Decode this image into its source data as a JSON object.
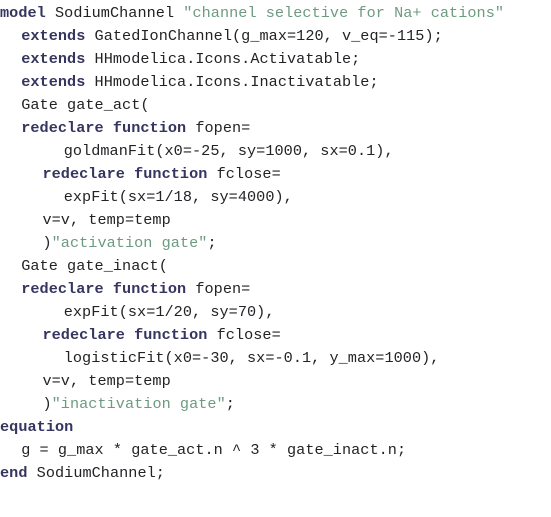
{
  "colors": {
    "background": "#ffffff",
    "keyword": "#35355f",
    "string": "#6d9b80",
    "plain": "#232327"
  },
  "code": {
    "language": "Modelica",
    "model_name": "SodiumChannel",
    "lines": [
      {
        "indent": 0,
        "tokens": [
          {
            "kind": "keyword",
            "text": "model"
          },
          {
            "kind": "plain",
            "text": " SodiumChannel "
          },
          {
            "kind": "string",
            "text": "\"channel selective for Na+ cations\""
          }
        ]
      },
      {
        "indent": 2,
        "tokens": [
          {
            "kind": "keyword",
            "text": "extends"
          },
          {
            "kind": "plain",
            "text": " GatedIonChannel(g_max=120, v_eq=-115);"
          }
        ]
      },
      {
        "indent": 2,
        "tokens": [
          {
            "kind": "keyword",
            "text": "extends"
          },
          {
            "kind": "plain",
            "text": " HHmodelica.Icons.Activatable;"
          }
        ]
      },
      {
        "indent": 2,
        "tokens": [
          {
            "kind": "keyword",
            "text": "extends"
          },
          {
            "kind": "plain",
            "text": " HHmodelica.Icons.Inactivatable;"
          }
        ]
      },
      {
        "indent": 2,
        "tokens": [
          {
            "kind": "plain",
            "text": "Gate gate_act("
          }
        ]
      },
      {
        "indent": 2,
        "tokens": [
          {
            "kind": "keyword",
            "text": "redeclare function"
          },
          {
            "kind": "plain",
            "text": " fopen="
          }
        ]
      },
      {
        "indent": 6,
        "tokens": [
          {
            "kind": "plain",
            "text": "goldmanFit(x0=-25, sy=1000, sx=0.1),"
          }
        ]
      },
      {
        "indent": 4,
        "tokens": [
          {
            "kind": "keyword",
            "text": "redeclare function"
          },
          {
            "kind": "plain",
            "text": " fclose="
          }
        ]
      },
      {
        "indent": 6,
        "tokens": [
          {
            "kind": "plain",
            "text": "expFit(sx=1/18, sy=4000),"
          }
        ]
      },
      {
        "indent": 4,
        "tokens": [
          {
            "kind": "plain",
            "text": "v=v, temp=temp"
          }
        ]
      },
      {
        "indent": 4,
        "tokens": [
          {
            "kind": "plain",
            "text": ")"
          },
          {
            "kind": "string",
            "text": "\"activation gate\""
          },
          {
            "kind": "plain",
            "text": ";"
          }
        ]
      },
      {
        "indent": 2,
        "tokens": [
          {
            "kind": "plain",
            "text": "Gate gate_inact("
          }
        ]
      },
      {
        "indent": 2,
        "tokens": [
          {
            "kind": "keyword",
            "text": "redeclare function"
          },
          {
            "kind": "plain",
            "text": " fopen="
          }
        ]
      },
      {
        "indent": 6,
        "tokens": [
          {
            "kind": "plain",
            "text": "expFit(sx=1/20, sy=70),"
          }
        ]
      },
      {
        "indent": 4,
        "tokens": [
          {
            "kind": "keyword",
            "text": "redeclare function"
          },
          {
            "kind": "plain",
            "text": " fclose="
          }
        ]
      },
      {
        "indent": 6,
        "tokens": [
          {
            "kind": "plain",
            "text": "logisticFit(x0=-30, sx=-0.1, y_max=1000),"
          }
        ]
      },
      {
        "indent": 4,
        "tokens": [
          {
            "kind": "plain",
            "text": "v=v, temp=temp"
          }
        ]
      },
      {
        "indent": 4,
        "tokens": [
          {
            "kind": "plain",
            "text": ")"
          },
          {
            "kind": "string",
            "text": "\"inactivation gate\""
          },
          {
            "kind": "plain",
            "text": ";"
          }
        ]
      },
      {
        "indent": 0,
        "tokens": [
          {
            "kind": "keyword",
            "text": "equation"
          }
        ]
      },
      {
        "indent": 2,
        "tokens": [
          {
            "kind": "plain",
            "text": "g = g_max * gate_act.n ^ 3 * gate_inact.n;"
          }
        ]
      },
      {
        "indent": 0,
        "tokens": [
          {
            "kind": "keyword",
            "text": "end"
          },
          {
            "kind": "plain",
            "text": " SodiumChannel;"
          }
        ]
      }
    ]
  }
}
